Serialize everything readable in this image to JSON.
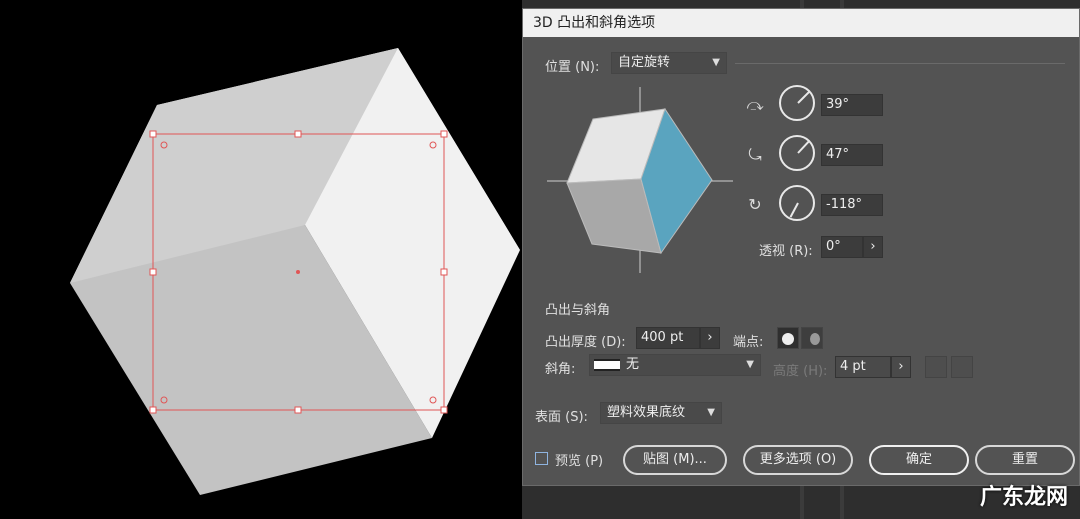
{
  "dialog": {
    "title": "3D 凸出和斜角选项",
    "position_label": "位置 (N):",
    "position_value": "自定旋转",
    "rotation": {
      "x_value": "39°",
      "y_value": "47°",
      "z_value": "-118°"
    },
    "perspective_label": "透视 (R):",
    "perspective_value": "0°",
    "extrude_section_title": "凸出与斜角",
    "extrude_depth_label": "凸出厚度 (D):",
    "extrude_depth_value": "400 pt",
    "cap_label": "端点:",
    "bevel_label": "斜角:",
    "bevel_value": "无",
    "height_label": "高度 (H):",
    "height_value": "4 pt",
    "surface_label": "表面 (S):",
    "surface_value": "塑料效果底纹",
    "preview_label": "预览 (P)",
    "map_button": "贴图 (M)...",
    "more_options_button": "更多选项 (O)",
    "ok_button": "确定",
    "reset_button": "重置"
  },
  "preview_cube_colors": {
    "top": "#e6e6e6",
    "left": "#a8a8a8",
    "right": "#5aa4bf"
  },
  "watermark": "广东龙网"
}
